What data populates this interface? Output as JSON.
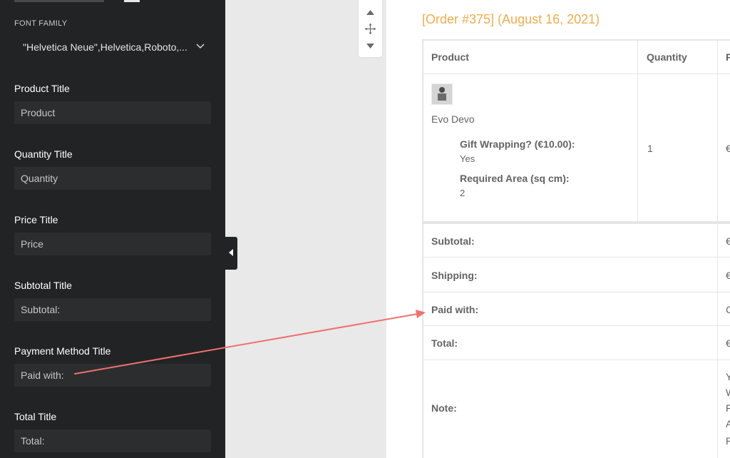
{
  "sidebar": {
    "font_family": {
      "label": "FONT FAMILY",
      "value": "\"Helvetica Neue\",Helvetica,Roboto,..."
    },
    "fields": [
      {
        "title": "Product Title",
        "value": "Product"
      },
      {
        "title": "Quantity Title",
        "value": "Quantity"
      },
      {
        "title": "Price Title",
        "value": "Price"
      },
      {
        "title": "Subtotal Title",
        "value": "Subtotal:"
      },
      {
        "title": "Payment Method Title",
        "value": "Paid with:"
      },
      {
        "title": "Total Title",
        "value": "Total:"
      }
    ]
  },
  "email": {
    "heading": "[Order #375] (August 16, 2021)",
    "heading_color": "#f0ad4e",
    "table": {
      "headers": [
        "Product",
        "Quantity",
        "P"
      ],
      "item": {
        "name": "Evo Devo",
        "quantity": "1",
        "price_partial": "€",
        "meta": [
          {
            "key": "Gift Wrapping? (€10.00):",
            "value": "Yes"
          },
          {
            "key": "Required Area (sq cm):",
            "value": "2"
          }
        ]
      },
      "totals": [
        {
          "label": "Subtotal:",
          "value": "€"
        },
        {
          "label": "Shipping:",
          "value": "€"
        },
        {
          "label": "Paid with:",
          "value": "C"
        },
        {
          "label": "Total:",
          "value": "€"
        }
      ],
      "note": {
        "label": "Note:",
        "lines": [
          "Y",
          "W",
          "F",
          "A",
          "P"
        ]
      }
    }
  },
  "annotation": {
    "color": "#f07070"
  }
}
